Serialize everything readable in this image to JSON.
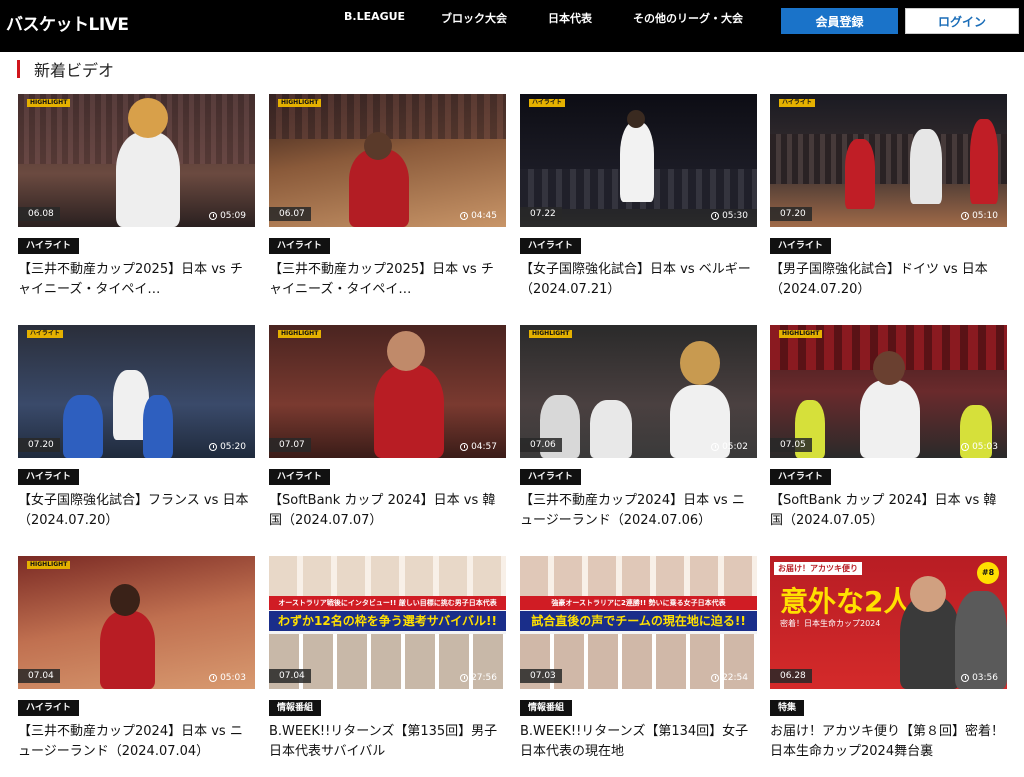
{
  "header": {
    "logo": "バスケットLIVE",
    "nav": [
      "B.LEAGUE",
      "ブロック大会",
      "日本代表",
      "その他のリーグ・大会"
    ],
    "register_label": "会員登録",
    "login_label": "ログイン"
  },
  "section": {
    "title": "新着ビデオ"
  },
  "videos": [
    {
      "badge": "HIGHLIGHT",
      "date": "06.08",
      "duration": "05:09",
      "tag": "ハイライト",
      "title": "【三井不動産カップ2025】日本 vs チャイニーズ・タイペイ…"
    },
    {
      "badge": "HIGHLIGHT",
      "date": "06.07",
      "duration": "04:45",
      "tag": "ハイライト",
      "title": "【三井不動産カップ2025】日本 vs チャイニーズ・タイペイ…"
    },
    {
      "badge": "ハイライト",
      "date": "07.22",
      "duration": "05:30",
      "tag": "ハイライト",
      "title": "【女子国際強化試合】日本 vs ベルギー（2024.07.21）"
    },
    {
      "badge": "ハイライト",
      "date": "07.20",
      "duration": "05:10",
      "tag": "ハイライト",
      "title": "【男子国際強化試合】ドイツ vs 日本（2024.07.20）"
    },
    {
      "badge": "ハイライト",
      "date": "07.20",
      "duration": "05:20",
      "tag": "ハイライト",
      "title": "【女子国際強化試合】フランス vs 日本（2024.07.20）"
    },
    {
      "badge": "HIGHLIGHT",
      "date": "07.07",
      "duration": "04:57",
      "tag": "ハイライト",
      "title": "【SoftBank カップ 2024】日本 vs 韓国（2024.07.07）"
    },
    {
      "badge": "HIGHLIGHT",
      "date": "07.06",
      "duration": "05:02",
      "tag": "ハイライト",
      "title": "【三井不動産カップ2024】日本 vs ニュージーランド（2024.07.06）"
    },
    {
      "badge": "HIGHLIGHT",
      "date": "07.05",
      "duration": "05:03",
      "tag": "ハイライト",
      "title": "【SoftBank カップ 2024】日本 vs 韓国（2024.07.05）"
    },
    {
      "badge": "HIGHLIGHT",
      "date": "07.04",
      "duration": "05:03",
      "tag": "ハイライト",
      "title": "【三井不動産カップ2024】日本 vs ニュージーランド（2024.07.04）"
    },
    {
      "badge": "",
      "date": "07.04",
      "duration": "27:56",
      "tag": "情報番組",
      "title": "B.WEEK!!リターンズ【第135回】男子日本代表サバイバル",
      "banner_top": "オーストラリア戦後にインタビュー!! 厳しい目標に挑む男子日本代表",
      "banner_main": "わずか12名の枠を争う選考サバイバル!!"
    },
    {
      "badge": "",
      "date": "07.03",
      "duration": "22:54",
      "tag": "情報番組",
      "title": "B.WEEK!!リターンズ【第134回】女子日本代表の現在地",
      "banner_top": "強豪オーストラリアに2連勝!! 勢いに乗る女子日本代表",
      "banner_main": "試合直後の声でチームの現在地に迫る!!"
    },
    {
      "badge": "",
      "date": "06.28",
      "duration": "03:56",
      "tag": "特集",
      "title": "お届け！アカツキ便り【第８回】密着！日本生命カップ2024舞台裏",
      "banner_top": "お届け！アカツキ便り",
      "banner_main": "意外な2人",
      "banner_sub": "密着！日本生命カップ2024",
      "episode": "#8"
    }
  ],
  "colors": {
    "accent": "#d0151c",
    "register": "#1a73c9",
    "badge": "#e5b100"
  }
}
